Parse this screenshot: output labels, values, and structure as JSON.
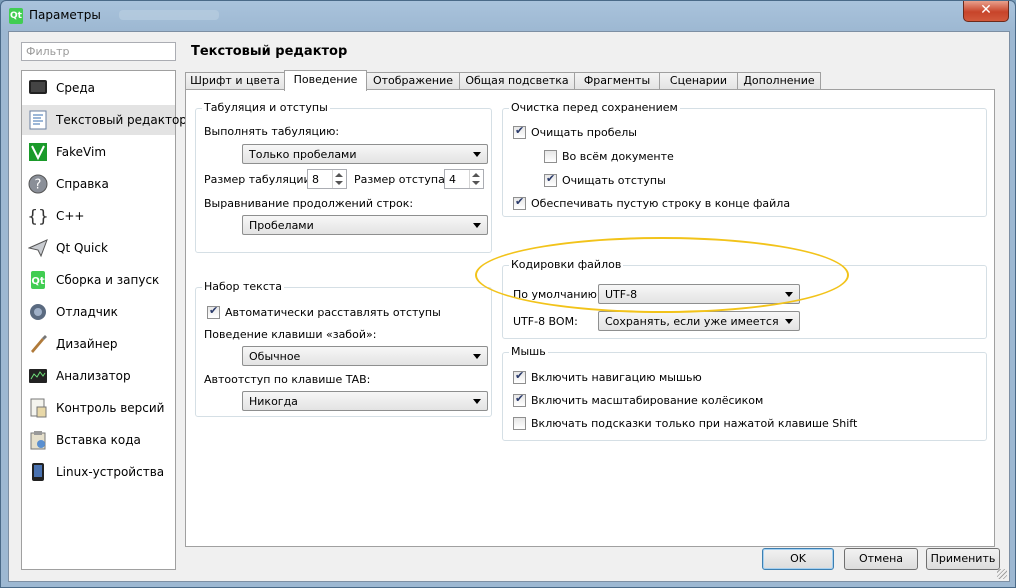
{
  "window": {
    "title": "Параметры"
  },
  "filter": {
    "placeholder": "Фильтр"
  },
  "sidebar": {
    "items": [
      {
        "label": "Среда",
        "icon": "monitor-icon"
      },
      {
        "label": "Текстовый редактор",
        "icon": "text-editor-icon"
      },
      {
        "label": "FakeVim",
        "icon": "fakevim-icon"
      },
      {
        "label": "Справка",
        "icon": "help-icon"
      },
      {
        "label": "C++",
        "icon": "braces-icon"
      },
      {
        "label": "Qt Quick",
        "icon": "paper-plane-icon"
      },
      {
        "label": "Сборка и запуск",
        "icon": "build-run-icon"
      },
      {
        "label": "Отладчик",
        "icon": "debugger-icon"
      },
      {
        "label": "Дизайнер",
        "icon": "designer-icon"
      },
      {
        "label": "Анализатор",
        "icon": "analyzer-icon"
      },
      {
        "label": "Контроль версий",
        "icon": "version-control-icon"
      },
      {
        "label": "Вставка кода",
        "icon": "code-paste-icon"
      },
      {
        "label": "Linux-устройства",
        "icon": "device-icon"
      }
    ],
    "selected": "Текстовый редактор"
  },
  "page": {
    "title": "Текстовый редактор"
  },
  "tabs": [
    {
      "label": "Шрифт и цвета"
    },
    {
      "label": "Поведение"
    },
    {
      "label": "Отображение"
    },
    {
      "label": "Общая подсветка"
    },
    {
      "label": "Фрагменты"
    },
    {
      "label": "Сценарии"
    },
    {
      "label": "Дополнение"
    }
  ],
  "active_tab": "Поведение",
  "tabs_indent": {
    "title": "Табуляция и отступы",
    "tab_policy_label": "Выполнять табуляцию:",
    "tab_policy_value": "Только пробелами",
    "tab_size_label": "Размер табуляции:",
    "tab_size_value": "8",
    "indent_size_label": "Размер отступа:",
    "indent_size_value": "4",
    "continuation_label": "Выравнивание продолжений строк:",
    "continuation_value": "Пробелами"
  },
  "typing": {
    "title": "Набор текста",
    "auto_indent_label": "Автоматически расставлять отступы",
    "auto_indent_checked": true,
    "backspace_label": "Поведение клавиши «забой»:",
    "backspace_value": "Обычное",
    "tab_key_label": "Автоотступ по клавише TAB:",
    "tab_key_value": "Никогда"
  },
  "cleanup": {
    "title": "Очистка перед сохранением",
    "clean_ws_label": "Очищать пробелы",
    "clean_ws_checked": true,
    "entire_doc_label": "Во всём документе",
    "entire_doc_checked": false,
    "clean_indent_label": "Очищать отступы",
    "clean_indent_checked": true,
    "newline_label": "Обеспечивать пустую строку в конце файла",
    "newline_checked": true
  },
  "encodings": {
    "title": "Кодировки файлов",
    "default_label": "По умолчанию:",
    "default_value": "UTF-8",
    "bom_label": "UTF-8 BOM:",
    "bom_value": "Сохранять, если уже имеется"
  },
  "mouse": {
    "title": "Мышь",
    "nav_label": "Включить навигацию мышью",
    "nav_checked": true,
    "zoom_label": "Включить масштабирование колёсиком",
    "zoom_checked": true,
    "tooltips_label": "Включать подсказки только при нажатой клавише Shift",
    "tooltips_checked": false
  },
  "buttons": {
    "ok": "OK",
    "cancel": "Отмена",
    "apply": "Применить"
  },
  "colors": {
    "highlight": "#f2c31a",
    "selected_item": "#e3e3e3",
    "close_button": "#c7442a"
  }
}
